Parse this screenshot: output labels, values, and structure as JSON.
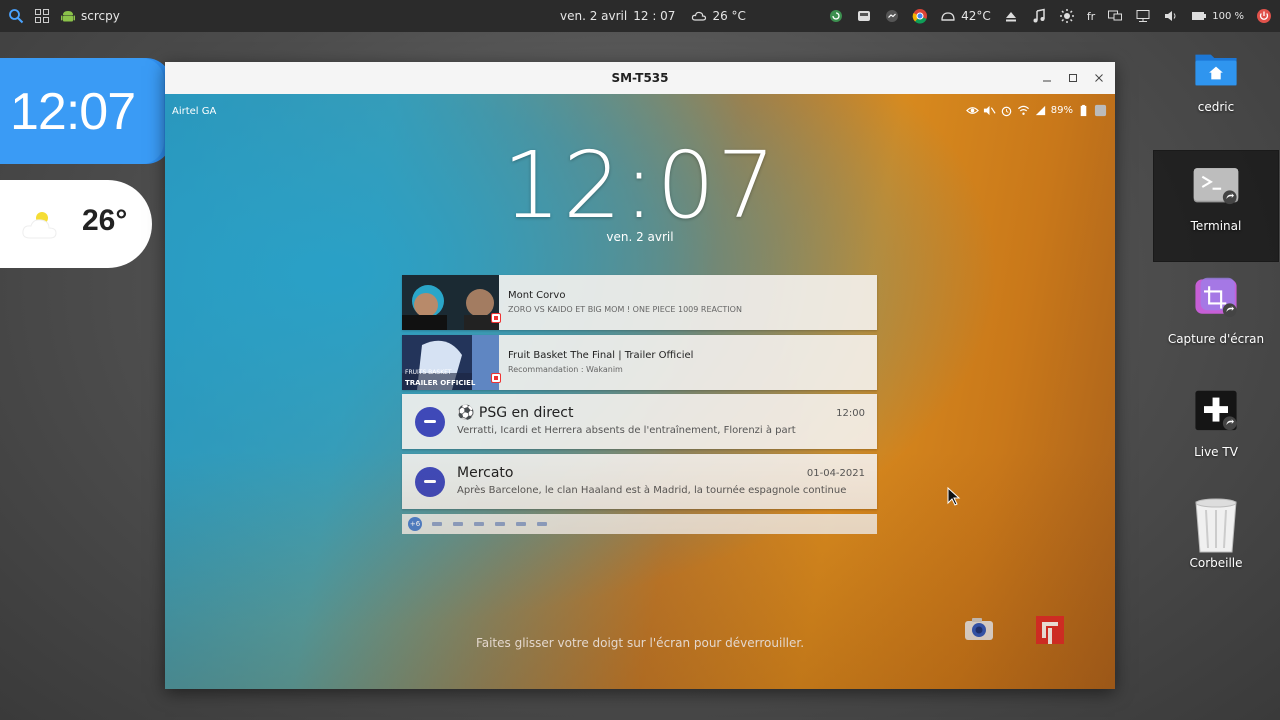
{
  "topbar": {
    "app_name": "scrcpy",
    "date": "ven. 2 avril",
    "time": "12 : 07",
    "weather_temp": "26 °C",
    "cpu_temp": "42°C",
    "lang": "fr",
    "battery": "100 %"
  },
  "widgets": {
    "clock_time": "12:07",
    "weather_temp": "26°"
  },
  "desktop_icons": [
    {
      "label": "cedric",
      "icon": "home-folder-icon"
    },
    {
      "label": "Terminal",
      "icon": "terminal-icon"
    },
    {
      "label": "Capture d'écran",
      "icon": "screenshot-icon"
    },
    {
      "label": "Live TV",
      "icon": "live-tv-icon"
    },
    {
      "label": "Corbeille",
      "icon": "trash-icon"
    }
  ],
  "window": {
    "title": "SM-T535"
  },
  "device": {
    "carrier": "Airtel GA",
    "battery": "89%",
    "clock": "12:07",
    "date": "ven. 2 avril",
    "unlock_hint": "Faites glisser votre doigt sur l'écran pour déverrouiller."
  },
  "notifications": [
    {
      "title": "Mont Corvo",
      "subtitle": "ZORO VS KAIDO ET BIG MOM ! ONE PIECE 1009 REACTION",
      "type": "youtube"
    },
    {
      "title": "Fruit Basket The Final | Trailer Officiel",
      "subtitle": "Recommandation : Wakanim",
      "thumb_text_1": "FRUITS BASKET",
      "thumb_text_2": "TRAILER OFFICIEL",
      "type": "youtube"
    },
    {
      "title": "⚽ PSG en direct",
      "subtitle": "Verratti, Icardi et Herrera absents de l'entraînement, Florenzi à part",
      "time": "12:00",
      "type": "app"
    },
    {
      "title": "Mercato",
      "subtitle": "Après Barcelone, le clan Haaland est à Madrid, la tournée espagnole continue",
      "time": "01-04-2021",
      "type": "app"
    }
  ],
  "more_notifications": "+6",
  "colors": {
    "clock_widget": "#3a9bf5",
    "app_icon": "#3f49b8",
    "flipboard": "#e12828"
  }
}
